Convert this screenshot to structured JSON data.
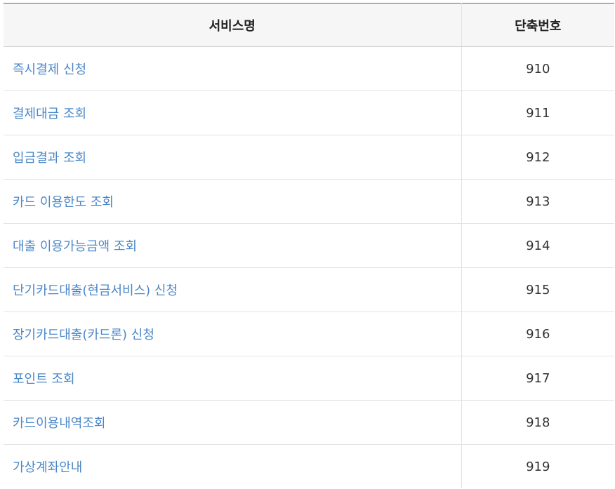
{
  "table": {
    "headers": {
      "service": "서비스명",
      "code": "단축번호"
    },
    "rows": [
      {
        "service": "즉시결제 신청",
        "code": "910"
      },
      {
        "service": "결제대금 조회",
        "code": "911"
      },
      {
        "service": "입금결과 조회",
        "code": "912"
      },
      {
        "service": "카드 이용한도 조회",
        "code": "913"
      },
      {
        "service": "대출 이용가능금액 조회",
        "code": "914"
      },
      {
        "service": "단기카드대출(현금서비스) 신청",
        "code": "915"
      },
      {
        "service": "장기카드대출(카드론) 신청",
        "code": "916"
      },
      {
        "service": "포인트 조회",
        "code": "917"
      },
      {
        "service": "카드이용내역조회",
        "code": "918"
      },
      {
        "service": "가상계좌안내",
        "code": "919"
      }
    ]
  },
  "colors": {
    "link": "#4a87c8",
    "header_bg": "#f6f6f6",
    "text": "#333333"
  }
}
